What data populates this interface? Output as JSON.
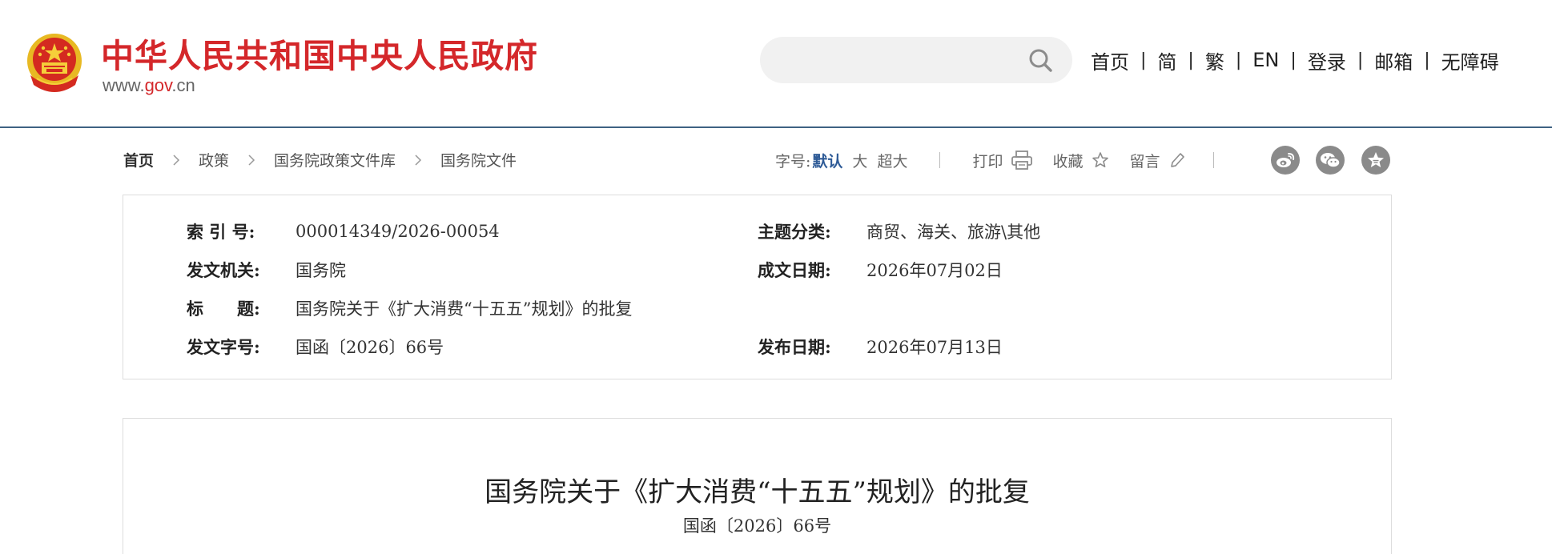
{
  "header": {
    "site_title": "中华人民共和国中央人民政府",
    "url_prefix": "www.",
    "url_mid": "gov",
    "url_suffix": ".cn",
    "search": {
      "value": "",
      "placeholder": ""
    },
    "nav": [
      {
        "label": "首页"
      },
      {
        "label": "简"
      },
      {
        "label": "繁"
      },
      {
        "label": "EN"
      },
      {
        "label": "登录"
      },
      {
        "label": "邮箱"
      },
      {
        "label": "无障碍"
      }
    ]
  },
  "breadcrumb": [
    "首页",
    "政策",
    "国务院政策文件库",
    "国务院文件"
  ],
  "tools": {
    "font_size_label": "字号:",
    "font_default": "默认",
    "font_large": "大",
    "font_xlarge": "超大",
    "print": "打印",
    "favorite": "收藏",
    "comment": "留言"
  },
  "info": {
    "index_label": "索 引 号:",
    "index_value": "000014349/2026-00054",
    "topic_label": "主题分类:",
    "topic_value": "商贸、海关、旅游\\其他",
    "issuer_label": "发文机关:",
    "issuer_value": "国务院",
    "date_label": "成文日期:",
    "date_value": "2026年07月02日",
    "title_label": "标　　题:",
    "title_value": "国务院关于《扩大消费“十五五”规划》的批复",
    "docno_label": "发文字号:",
    "docno_value": "国函〔2026〕66号",
    "pubdate_label": "发布日期:",
    "pubdate_value": "2026年07月13日"
  },
  "article": {
    "title": "国务院关于《扩大消费“十五五”规划》的批复",
    "doc_no": "国函〔2026〕66号"
  },
  "colors": {
    "brand_red": "#d4272a",
    "header_rule": "#3f6282",
    "link_blue": "#2d5a96",
    "share_gray": "#8a8a8a"
  },
  "icons": {
    "emblem": "national-emblem-icon",
    "search": "search-icon",
    "print": "printer-icon",
    "favorite": "star-icon",
    "comment": "pencil-icon",
    "share": [
      "weibo-icon",
      "wechat-icon",
      "star-share-icon"
    ]
  }
}
